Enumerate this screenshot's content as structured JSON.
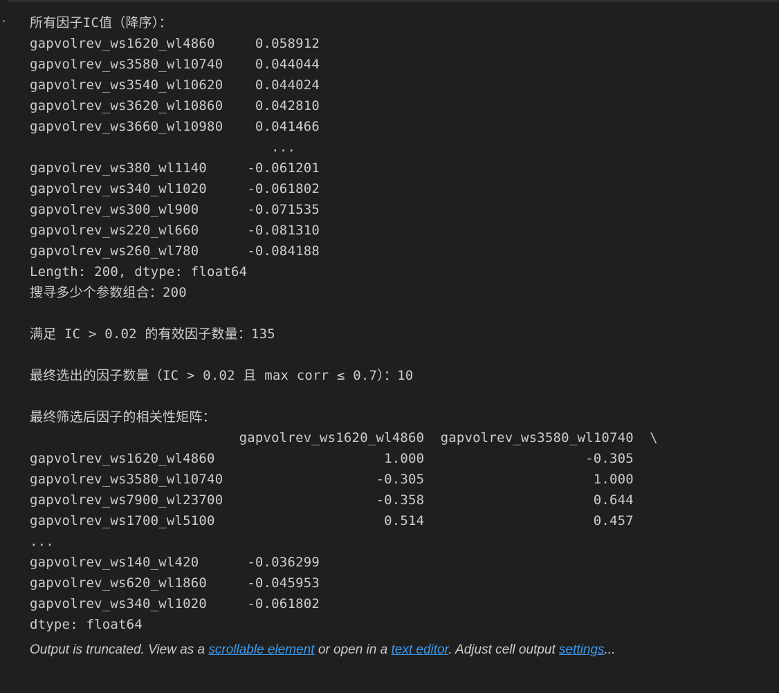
{
  "output": {
    "lines": [
      "所有因子IC值（降序）：",
      "gapvolrev_ws1620_wl4860     0.058912",
      "gapvolrev_ws3580_wl10740    0.044044",
      "gapvolrev_ws3540_wl10620    0.044024",
      "gapvolrev_ws3620_wl10860    0.042810",
      "gapvolrev_ws3660_wl10980    0.041466",
      "                              ...   ",
      "gapvolrev_ws380_wl1140     -0.061201",
      "gapvolrev_ws340_wl1020     -0.061802",
      "gapvolrev_ws300_wl900      -0.071535",
      "gapvolrev_ws220_wl660      -0.081310",
      "gapvolrev_ws260_wl780      -0.084188",
      "Length: 200, dtype: float64",
      "搜寻多少个参数组合：200",
      "",
      "满足 IC > 0.02 的有效因子数量：135",
      "",
      "最终选出的因子数量（IC > 0.02 且 max corr ≤ 0.7）：10",
      "",
      "最终筛选后因子的相关性矩阵：",
      "                          gapvolrev_ws1620_wl4860  gapvolrev_ws3580_wl10740  \\",
      "gapvolrev_ws1620_wl4860                     1.000                    -0.305",
      "gapvolrev_ws3580_wl10740                   -0.305                     1.000",
      "gapvolrev_ws7900_wl23700                   -0.358                     0.644",
      "gapvolrev_ws1700_wl5100                     0.514                     0.457",
      "...",
      "gapvolrev_ws140_wl420      -0.036299",
      "gapvolrev_ws620_wl1860     -0.045953",
      "gapvolrev_ws340_wl1020     -0.061802",
      "dtype: float64"
    ]
  },
  "truncation": {
    "prefix": "Output is truncated. View as a ",
    "scrollable_link": "scrollable element",
    "middle": " or open in a ",
    "editor_link": "text editor",
    "middle2": ". Adjust cell output ",
    "settings_link": "settings",
    "suffix": "...",
    "link_color": "#3b9bef"
  },
  "gutter": {
    "marker": "·"
  }
}
